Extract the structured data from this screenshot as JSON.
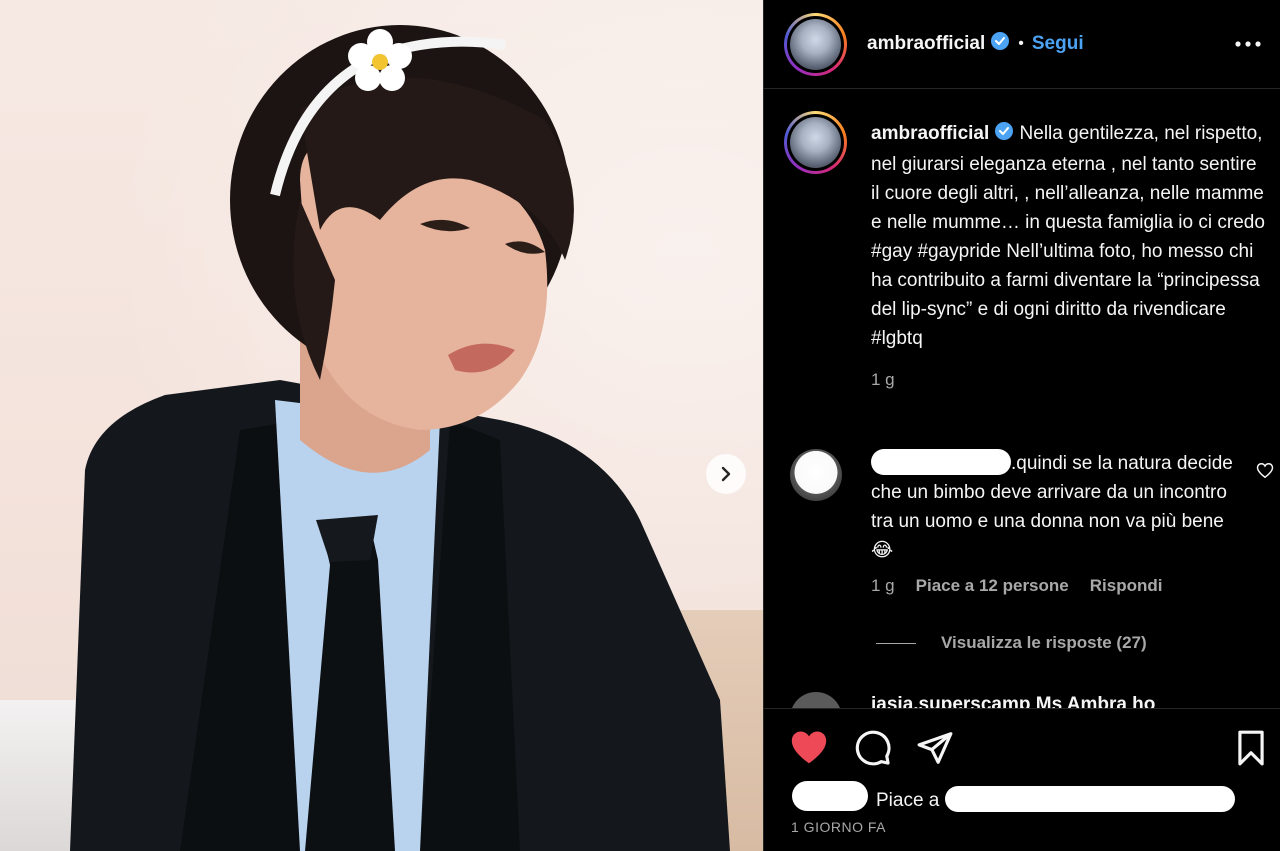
{
  "post": {
    "username": "ambraofficial",
    "separator": "•",
    "follow_label": "Segui",
    "caption_text": "Nella gentilezza, nel rispetto, nel giurarsi eleganza eterna , nel tanto sentire il cuore degli altri, , nell’alleanza, nelle mamme e nelle mumme… in questa famiglia io ci credo #gay #gaypride Nell’ultima foto, ho messo chi ha contribuito a farmi diventare la “principessa del lip-sync” e di ogni diritto da rivendicare #lgbtq",
    "caption_time": "1 g"
  },
  "comments": [
    {
      "text": ".quindi se la natura decide che un bimbo deve arrivare da un incontro tra un uomo e una donna non va più bene😂",
      "time": "1 g",
      "likes": "Piace a 12 persone",
      "reply_label": "Rispondi",
      "view_replies": "Visualizza le risposte (27)"
    }
  ],
  "next_comment_preview": "jasia.superscamp  Ms Ambra ho",
  "footer": {
    "likes_prefix": "Piace a",
    "date": "1 GIORNO FA"
  },
  "colors": {
    "accent": "#4ca3f4",
    "like_red": "#ed4956",
    "text_secondary": "#a8a8a8"
  },
  "icons": [
    "verified-badge-icon",
    "more-options-icon",
    "chevron-right-icon",
    "heart-icon",
    "comment-icon",
    "share-icon",
    "bookmark-icon"
  ]
}
